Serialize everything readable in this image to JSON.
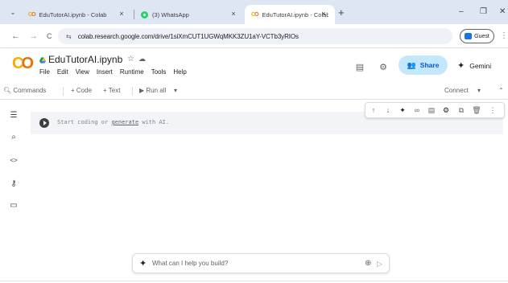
{
  "browser": {
    "tabs": [
      {
        "title": "EduTutorAI.ipynb - Colab",
        "favicon": "colab-icon",
        "active": false
      },
      {
        "title": "(3) WhatsApp",
        "favicon": "whatsapp-icon",
        "active": false
      },
      {
        "title": "EduTutorAI.ipynb - Colab",
        "favicon": "colab-icon",
        "active": true
      }
    ],
    "close_glyph": "×",
    "new_tab_glyph": "+",
    "tab_menu_glyph": "⌄",
    "window_controls": {
      "minimize": "–",
      "maximize": "❐",
      "close": "✕"
    },
    "nav": {
      "back": "←",
      "forward": "→",
      "reload": "C"
    },
    "site_icon": "⇆",
    "url": "colab.research.google.com/drive/1siXmCUT1UGWqMKK3ZU1aY-VCTb3yRIOs",
    "profile_label": "Guest",
    "menu_glyph": "⋮"
  },
  "colab": {
    "logo": {
      "c1": "C",
      "c2": "O"
    },
    "notebook_title": "EduTutorAI.ipynb",
    "star_glyph": "☆",
    "cloud_glyph": "☁",
    "menu": [
      "File",
      "Edit",
      "View",
      "Insert",
      "Runtime",
      "Tools",
      "Help"
    ],
    "comments_glyph": "▤",
    "settings_glyph": "⚙",
    "share_icon": "👥",
    "share_label": "Share",
    "gemini_glyph": "✦",
    "gemini_label": "Gemini",
    "colors": {
      "logo_yellow": "#f9ab00",
      "logo_orange": "#e8710a",
      "share_bg": "#c2e7ff",
      "share_fg": "#0b57d0"
    }
  },
  "toolbar": {
    "commands_glyph": "🔍︎",
    "commands": "Commands",
    "code": "+ Code",
    "text": "+ Text",
    "run_all": "▶ Run all",
    "run_all_caret": "▾",
    "connect": "Connect",
    "connect_caret": "▾",
    "collapse": "⌃"
  },
  "left_rail": [
    {
      "icon": "table-of-contents-icon",
      "glyph": "☰"
    },
    {
      "icon": "find-icon",
      "glyph": "⌕"
    },
    {
      "icon": "code-snippets-icon",
      "glyph": "<>"
    },
    {
      "icon": "secrets-key-icon",
      "glyph": "⚷"
    },
    {
      "icon": "files-folder-icon",
      "glyph": "▭"
    }
  ],
  "cell_toolbar": [
    {
      "icon": "move-up-icon",
      "glyph": "↑"
    },
    {
      "icon": "move-down-icon",
      "glyph": "↓"
    },
    {
      "icon": "gemini-icon",
      "glyph": "✦"
    },
    {
      "icon": "link-icon",
      "glyph": "∞"
    },
    {
      "icon": "comment-icon",
      "glyph": "▤"
    },
    {
      "icon": "settings-icon",
      "glyph": "⚙"
    },
    {
      "icon": "mirror-cell-icon",
      "glyph": "⧉"
    },
    {
      "icon": "delete-icon",
      "glyph": "🗑︎"
    },
    {
      "icon": "more-icon",
      "glyph": "⋮"
    }
  ],
  "cell": {
    "placeholder_before": "Start coding or ",
    "placeholder_link": "generate",
    "placeholder_after": " with AI."
  },
  "prompt": {
    "spark": "✦",
    "placeholder": "What can I help you build?",
    "add_glyph": "⊕",
    "send_glyph": "▷"
  }
}
